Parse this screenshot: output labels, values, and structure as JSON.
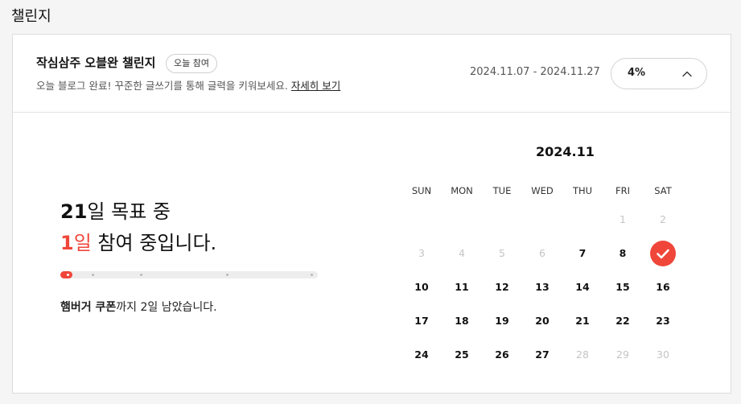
{
  "section": {
    "title": "챌린지"
  },
  "challenge": {
    "title": "작심삼주 오블완 챌린지",
    "badge": "오늘 참여",
    "description": "오늘 블로그 완료! 꾸준한 글쓰기를 통해 글력을 키워보세요.",
    "detail_link": "자세히 보기",
    "period": "2024.11.07 - 2024.11.27",
    "percent_label": "4%",
    "progress_fraction": 0.04
  },
  "goal": {
    "days_total": "21",
    "line1_suffix": "일 목표 중",
    "days_done": "1",
    "line2_unit": "일",
    "line2_suffix": " 참여 중입니다.",
    "reward_item": "햄버거 쿠폰",
    "reward_suffix": "까지 2일 남았습니다."
  },
  "calendar": {
    "title": "2024.11",
    "weekdays": [
      "SUN",
      "MON",
      "TUE",
      "WED",
      "THU",
      "FRI",
      "SAT"
    ],
    "rows": [
      [
        null,
        null,
        null,
        null,
        null,
        {
          "d": "1",
          "s": "inactive"
        },
        {
          "d": "2",
          "s": "inactive"
        }
      ],
      [
        {
          "d": "3",
          "s": "inactive"
        },
        {
          "d": "4",
          "s": "inactive"
        },
        {
          "d": "5",
          "s": "inactive"
        },
        {
          "d": "6",
          "s": "inactive"
        },
        {
          "d": "7",
          "s": "active"
        },
        {
          "d": "8",
          "s": "active"
        },
        {
          "d": "9",
          "s": "checked"
        }
      ],
      [
        {
          "d": "10",
          "s": "active"
        },
        {
          "d": "11",
          "s": "active"
        },
        {
          "d": "12",
          "s": "active"
        },
        {
          "d": "13",
          "s": "active"
        },
        {
          "d": "14",
          "s": "active"
        },
        {
          "d": "15",
          "s": "active"
        },
        {
          "d": "16",
          "s": "active"
        }
      ],
      [
        {
          "d": "17",
          "s": "active"
        },
        {
          "d": "18",
          "s": "active"
        },
        {
          "d": "19",
          "s": "active"
        },
        {
          "d": "20",
          "s": "active"
        },
        {
          "d": "21",
          "s": "active"
        },
        {
          "d": "22",
          "s": "active"
        },
        {
          "d": "23",
          "s": "active"
        }
      ],
      [
        {
          "d": "24",
          "s": "active"
        },
        {
          "d": "25",
          "s": "active"
        },
        {
          "d": "26",
          "s": "active"
        },
        {
          "d": "27",
          "s": "active"
        },
        {
          "d": "28",
          "s": "inactive"
        },
        {
          "d": "29",
          "s": "inactive"
        },
        {
          "d": "30",
          "s": "inactive"
        }
      ]
    ]
  },
  "colors": {
    "accent": "#f0463a",
    "inactive_day": "#c4c4c4"
  },
  "icons": {
    "expand": "chevron-up-icon",
    "checked_day": "check-icon"
  }
}
